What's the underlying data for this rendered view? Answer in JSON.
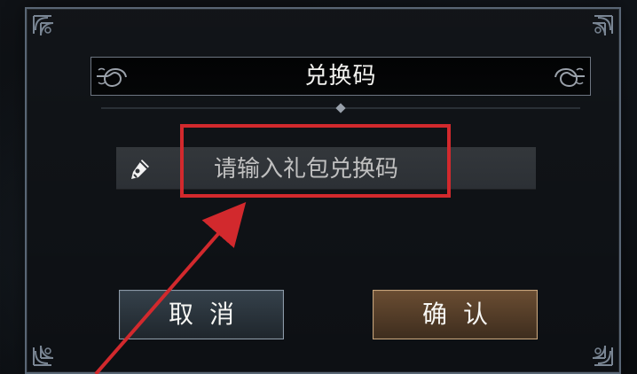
{
  "dialog": {
    "title": "兑换码",
    "input": {
      "placeholder": "请输入礼包兑换码",
      "value": ""
    },
    "buttons": {
      "cancel": "取消",
      "confirm": "确认"
    }
  },
  "icons": {
    "input_icon": "pen-icon",
    "title_left": "ornament-icon",
    "title_right": "ornament-icon"
  },
  "colors": {
    "accent_red": "#d2292d",
    "cancel_button": "#2a343d",
    "confirm_button": "#5a412b",
    "frame": "#596675",
    "input_background": "#303438"
  }
}
